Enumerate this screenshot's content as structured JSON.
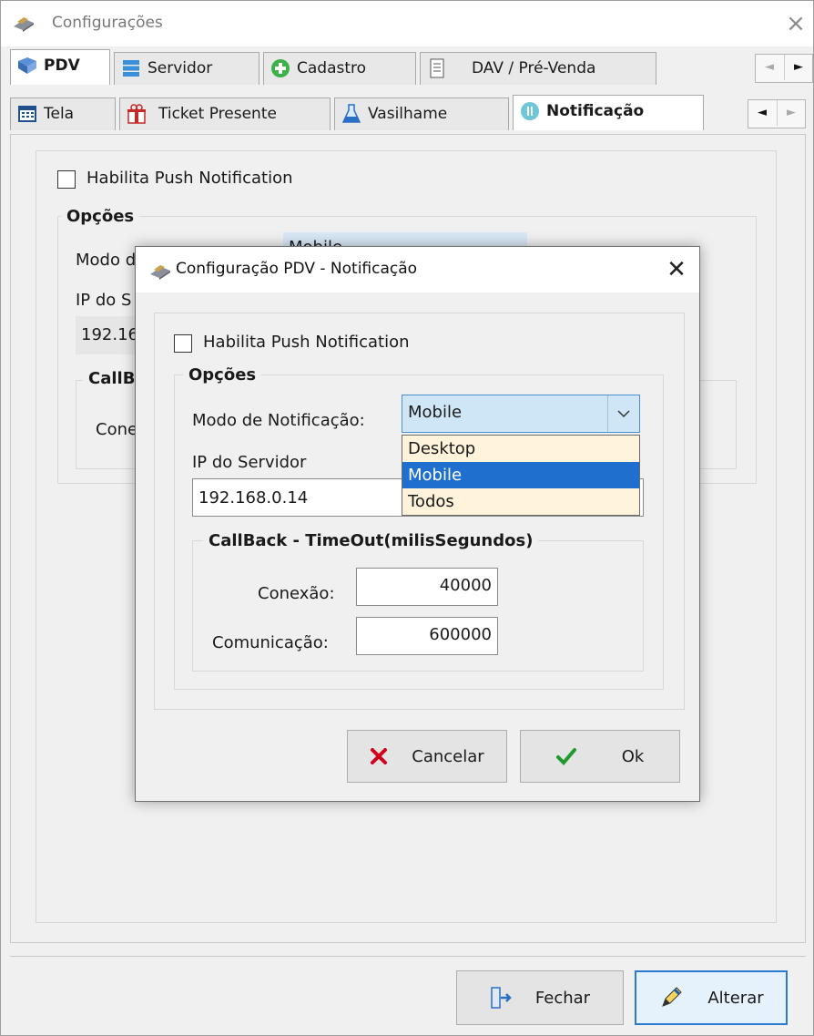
{
  "main_window": {
    "title": "Configurações",
    "close_glyph": "×"
  },
  "tabs_row1": [
    {
      "label": "PDV",
      "icon": "pdv-icon",
      "selected": true
    },
    {
      "label": "Servidor",
      "icon": "server-icon",
      "selected": false
    },
    {
      "label": "Cadastro",
      "icon": "add-green-icon",
      "selected": false
    },
    {
      "label": "DAV / Pré-Venda",
      "icon": "document-icon",
      "selected": false
    }
  ],
  "tabs_row2": [
    {
      "label": "Tela",
      "icon": "calculator-icon",
      "selected": false
    },
    {
      "label": "Ticket Presente",
      "icon": "gift-icon",
      "selected": false
    },
    {
      "label": "Vasilhame",
      "icon": "flask-icon",
      "selected": false
    },
    {
      "label": "Notificação",
      "icon": "notification-icon",
      "selected": true
    }
  ],
  "scroll_arrows": {
    "left": "◄",
    "right": "►"
  },
  "background_panel": {
    "push_label": "Habilita Push Notification",
    "options_title": "Opções",
    "mode_label_partial": "Modo d",
    "mode_value_partial": "Mobile",
    "ip_label_partial": "IP do S",
    "ip_value_partial": "192.16",
    "callback_partial": "CallB",
    "conexao_partial": "Cone"
  },
  "bottom_buttons": {
    "close_label": "Fechar",
    "alter_label": "Alterar"
  },
  "dialog": {
    "title": "Configuração PDV - Notificação",
    "close_glyph": "✕",
    "push_label": "Habilita Push Notification",
    "push_checked": false,
    "options_title": "Opções",
    "mode_label": "Modo de Notificação:",
    "mode_value": "Mobile",
    "dropdown_options": [
      "Desktop",
      "Mobile",
      "Todos"
    ],
    "dropdown_selected_index": 1,
    "ip_label": "IP do Servidor",
    "ip_value": "192.168.0.14",
    "callback_title": "CallBack - TimeOut(milisSegundos)",
    "conexao_label": "Conexão:",
    "conexao_value": "40000",
    "comunicacao_label": "Comunicação:",
    "comunicacao_value": "600000",
    "cancel_label": "Cancelar",
    "ok_label": "Ok"
  },
  "colors": {
    "dropdown_bg": "#fff3dc",
    "dropdown_selected": "#1f6fcf",
    "combo_bg": "#cfe6f7",
    "cancel_icon": "#d0021b",
    "ok_icon": "#1f9a2e"
  }
}
